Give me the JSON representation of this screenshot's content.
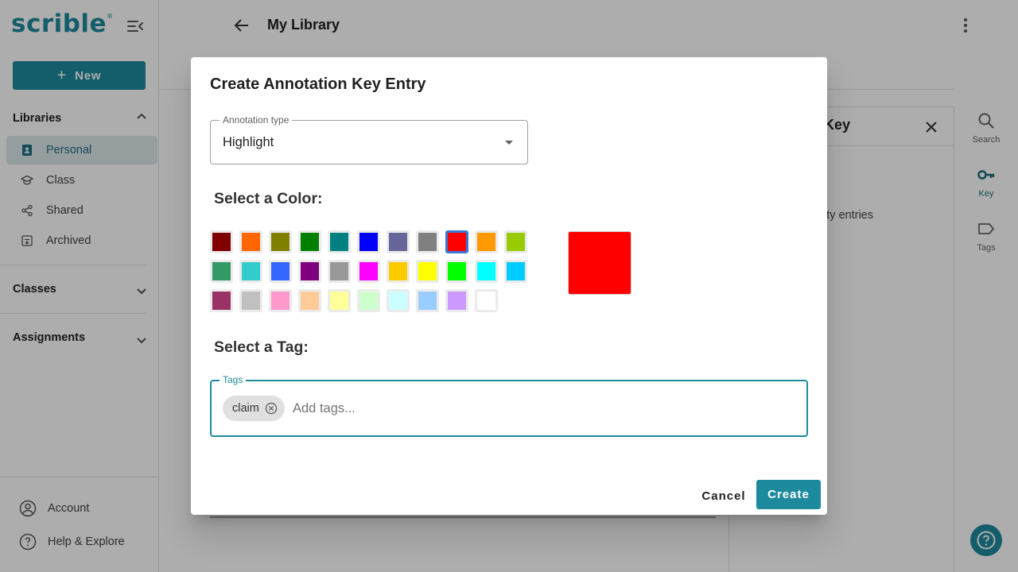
{
  "app": {
    "logo_text": "scrible",
    "logo_mark": "®"
  },
  "sidebar": {
    "new_label": "New",
    "libraries_title": "Libraries",
    "library_items": [
      {
        "label": "Personal",
        "icon": "contact-book-icon",
        "active": true
      },
      {
        "label": "Class",
        "icon": "graduation-cap-icon",
        "active": false
      },
      {
        "label": "Shared",
        "icon": "share-icon",
        "active": false
      },
      {
        "label": "Archived",
        "icon": "archive-box-icon",
        "active": false
      }
    ],
    "classes_title": "Classes",
    "assignments_title": "Assignments",
    "footer": {
      "account_label": "Account",
      "help_label": "Help & Explore"
    }
  },
  "header": {
    "title": "My Library"
  },
  "side_panel": {
    "title": "Key",
    "empty_text": "ty entries"
  },
  "rail": {
    "search_label": "Search",
    "key_label": "Key",
    "tags_label": "Tags"
  },
  "dialog": {
    "title": "Create Annotation Key Entry",
    "type_field": {
      "label": "Annotation type",
      "value": "Highlight"
    },
    "color_heading": "Select a Color:",
    "colors": [
      "#800000",
      "#ff6600",
      "#808000",
      "#008000",
      "#008080",
      "#0000ff",
      "#666699",
      "#808080",
      "#ff0000",
      "#ff9900",
      "#99cc00",
      "#339966",
      "#33cccc",
      "#3366ff",
      "#800080",
      "#999999",
      "#ff00ff",
      "#ffcc00",
      "#ffff00",
      "#00ff00",
      "#00ffff",
      "#00ccff",
      "#993366",
      "#c0c0c0",
      "#ff99cc",
      "#ffcc99",
      "#ffff99",
      "#ccffcc",
      "#ccffff",
      "#99ccff",
      "#cc99ff",
      "#ffffff"
    ],
    "selected_color": "#ff0000",
    "tag_heading": "Select a Tag:",
    "tags_field": {
      "label": "Tags",
      "placeholder": "Add tags..."
    },
    "tags": [
      "claim"
    ],
    "cancel_label": "Cancel",
    "create_label": "Create"
  }
}
